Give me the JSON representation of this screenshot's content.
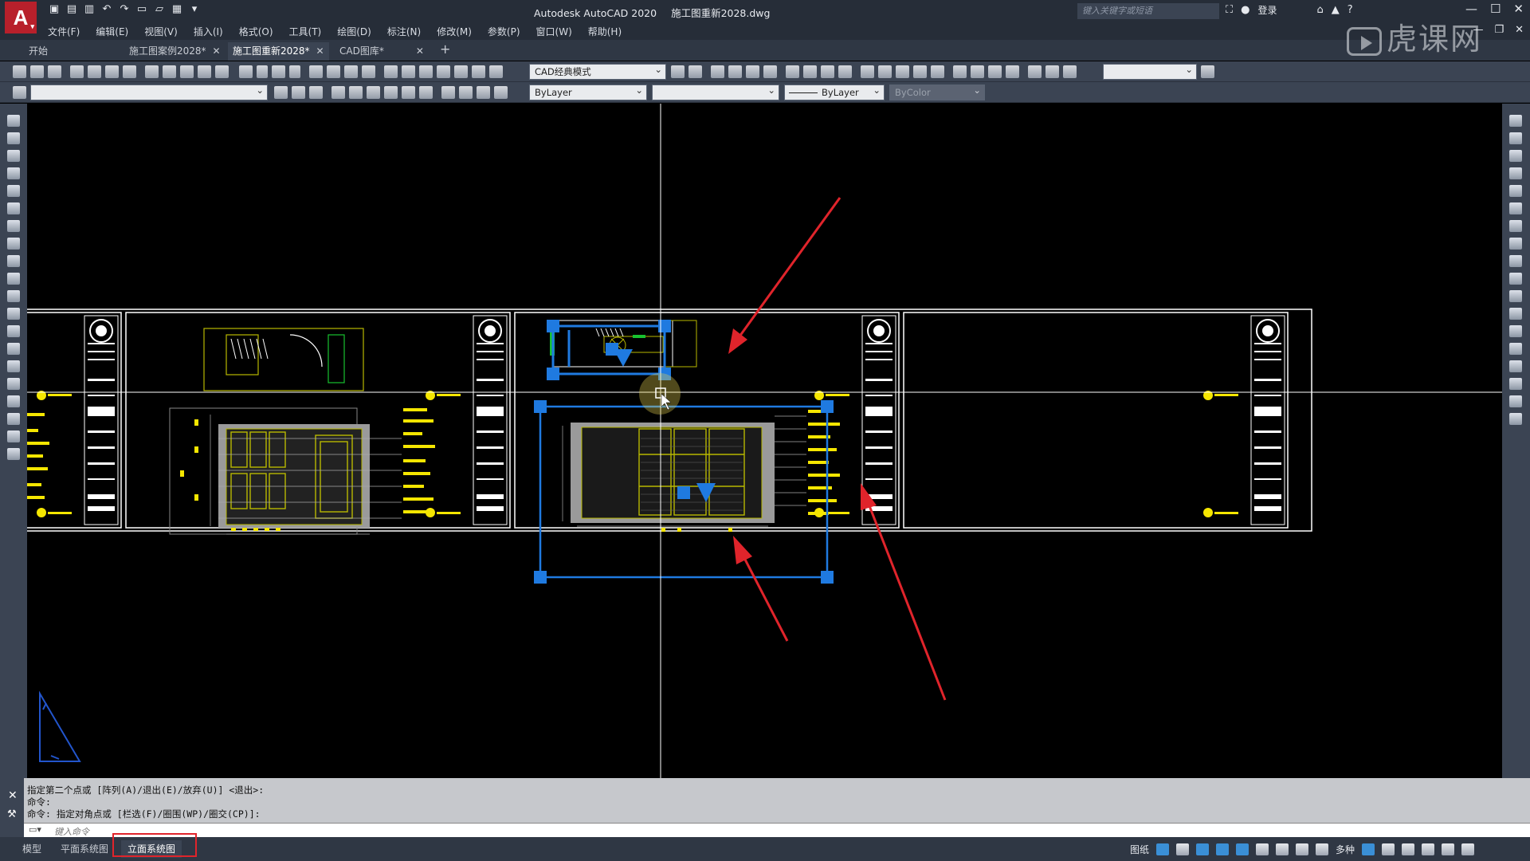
{
  "app": {
    "title": "Autodesk AutoCAD 2020",
    "filename": "施工图重新2028.dwg",
    "logo_letter": "A"
  },
  "search": {
    "placeholder": "键入关键字或短语"
  },
  "account": {
    "login_label": "登录"
  },
  "menu": [
    "文件(F)",
    "编辑(E)",
    "视图(V)",
    "插入(I)",
    "格式(O)",
    "工具(T)",
    "绘图(D)",
    "标注(N)",
    "修改(M)",
    "参数(P)",
    "窗口(W)",
    "帮助(H)"
  ],
  "tabs": [
    {
      "label": "开始"
    },
    {
      "label": "施工图案例2028*"
    },
    {
      "label": "施工图重新2028*"
    },
    {
      "label": "CAD图库*"
    }
  ],
  "toolbar": {
    "workspace": "CAD经典模式",
    "layer_color": "ByLayer",
    "linetype": "ByLayer",
    "plot_style": "ByColor"
  },
  "command": {
    "history": [
      "指定第二个点或 [阵列(A)/退出(E)/放弃(U)] <退出>:",
      "命令:",
      "命令: 指定对角点或 [栏选(F)/圈围(WP)/圈交(CP)]:"
    ],
    "input_placeholder": "键入命令"
  },
  "layout_tabs": [
    "模型",
    "平面系统图",
    "立面系统图"
  ],
  "status": {
    "paper_label": "图纸",
    "scale_label": "多种"
  },
  "watermark": "虎课网",
  "colors": {
    "accent_selection": "#1f7ae0",
    "drawing_yellow": "#f5e600",
    "arrow_red": "#e0242b"
  }
}
